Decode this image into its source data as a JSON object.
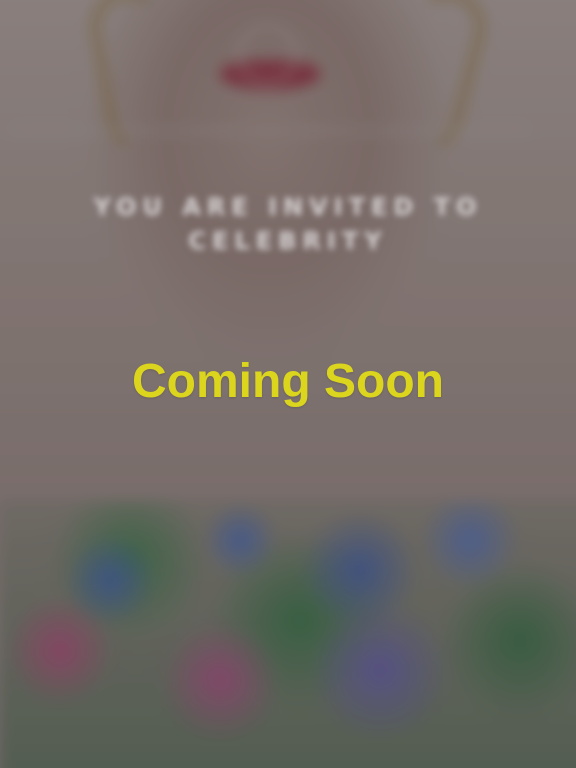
{
  "invitation": {
    "title": "YOU ARE INVITED TO CELEBRITY",
    "body": "",
    "details": "",
    "signature": ""
  },
  "overlay": {
    "message": "Coming Soon",
    "text_color": "#dcd51e"
  }
}
